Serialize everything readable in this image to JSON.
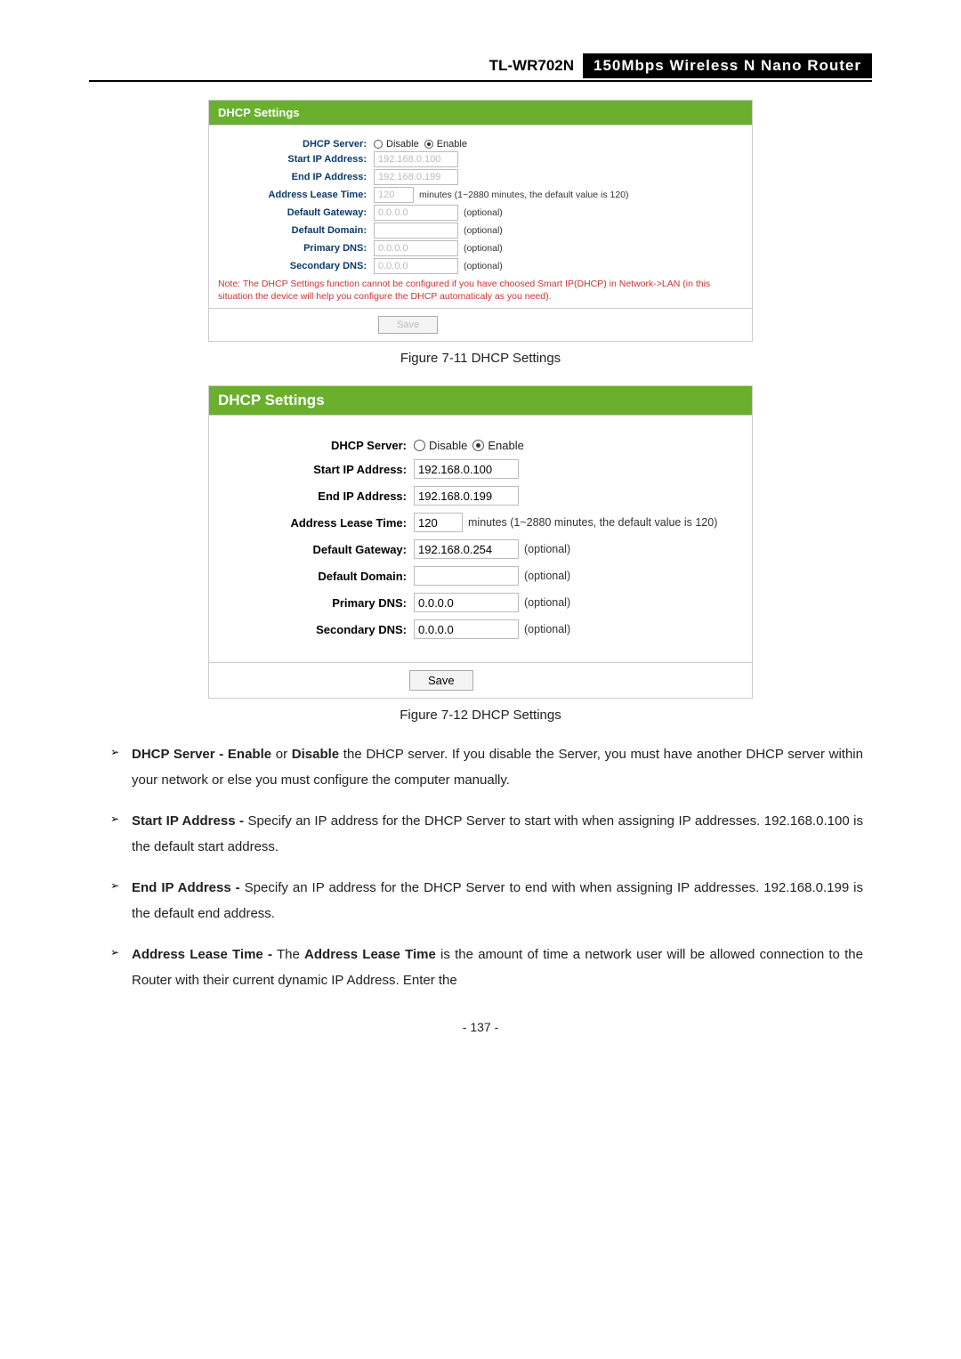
{
  "header": {
    "model": "TL-WR702N",
    "description": "150Mbps  Wireless  N  Nano  Router"
  },
  "panel1": {
    "title": "DHCP Settings",
    "labels": {
      "server": "DHCP Server:",
      "start": "Start IP Address:",
      "end": "End IP Address:",
      "lease": "Address Lease Time:",
      "gateway": "Default Gateway:",
      "domain": "Default Domain:",
      "pdns": "Primary DNS:",
      "sdns": "Secondary DNS:"
    },
    "radio": {
      "disable": "Disable",
      "enable": "Enable"
    },
    "values": {
      "start": "192.168.0.100",
      "end": "192.168.0.199",
      "lease": "120",
      "gateway": "0.0.0.0",
      "domain": "",
      "pdns": "0.0.0.0",
      "sdns": "0.0.0.0"
    },
    "hints": {
      "lease": "minutes (1~2880 minutes, the default value is 120)",
      "optional": "(optional)"
    },
    "note": "Note: The DHCP Settings function cannot be configured if you have choosed Smart IP(DHCP) in Network->LAN (in this situation the device will help you configure the DHCP automaticaly as you need).",
    "save": "Save"
  },
  "caption1": "Figure 7-11 DHCP Settings",
  "panel2": {
    "title": "DHCP Settings",
    "labels": {
      "server": "DHCP Server:",
      "start": "Start IP Address:",
      "end": "End IP Address:",
      "lease": "Address Lease Time:",
      "gateway": "Default Gateway:",
      "domain": "Default Domain:",
      "pdns": "Primary DNS:",
      "sdns": "Secondary DNS:"
    },
    "radio": {
      "disable": "Disable",
      "enable": "Enable"
    },
    "values": {
      "start": "192.168.0.100",
      "end": "192.168.0.199",
      "lease": "120",
      "gateway": "192.168.0.254",
      "domain": "",
      "pdns": "0.0.0.0",
      "sdns": "0.0.0.0"
    },
    "hints": {
      "lease": "minutes (1~2880 minutes, the default value is 120)",
      "optional": "(optional)"
    },
    "save": "Save"
  },
  "caption2": "Figure 7-12 DHCP Settings",
  "list": {
    "item1": {
      "b1": "DHCP Server - Enable",
      "t1": " or ",
      "b2": "Disable",
      "t2": " the DHCP server. If you disable the Server, you must have another DHCP server within your network or else you must configure the computer manually."
    },
    "item2": {
      "b1": "Start IP Address -",
      "t1": " Specify an IP address for the DHCP Server to start with when assigning IP addresses. 192.168.0.100 is the default start address."
    },
    "item3": {
      "b1": "End IP Address -",
      "t1": " Specify an IP address for the DHCP Server to end with when assigning IP addresses. 192.168.0.199 is the default end address."
    },
    "item4": {
      "b1": "Address Lease Time -",
      "t1": " The ",
      "b2": "Address Lease Time",
      "t2": " is the amount of time a network user will be allowed connection to the Router with their current dynamic IP Address. Enter the"
    }
  },
  "pageNumber": "- 137 -"
}
